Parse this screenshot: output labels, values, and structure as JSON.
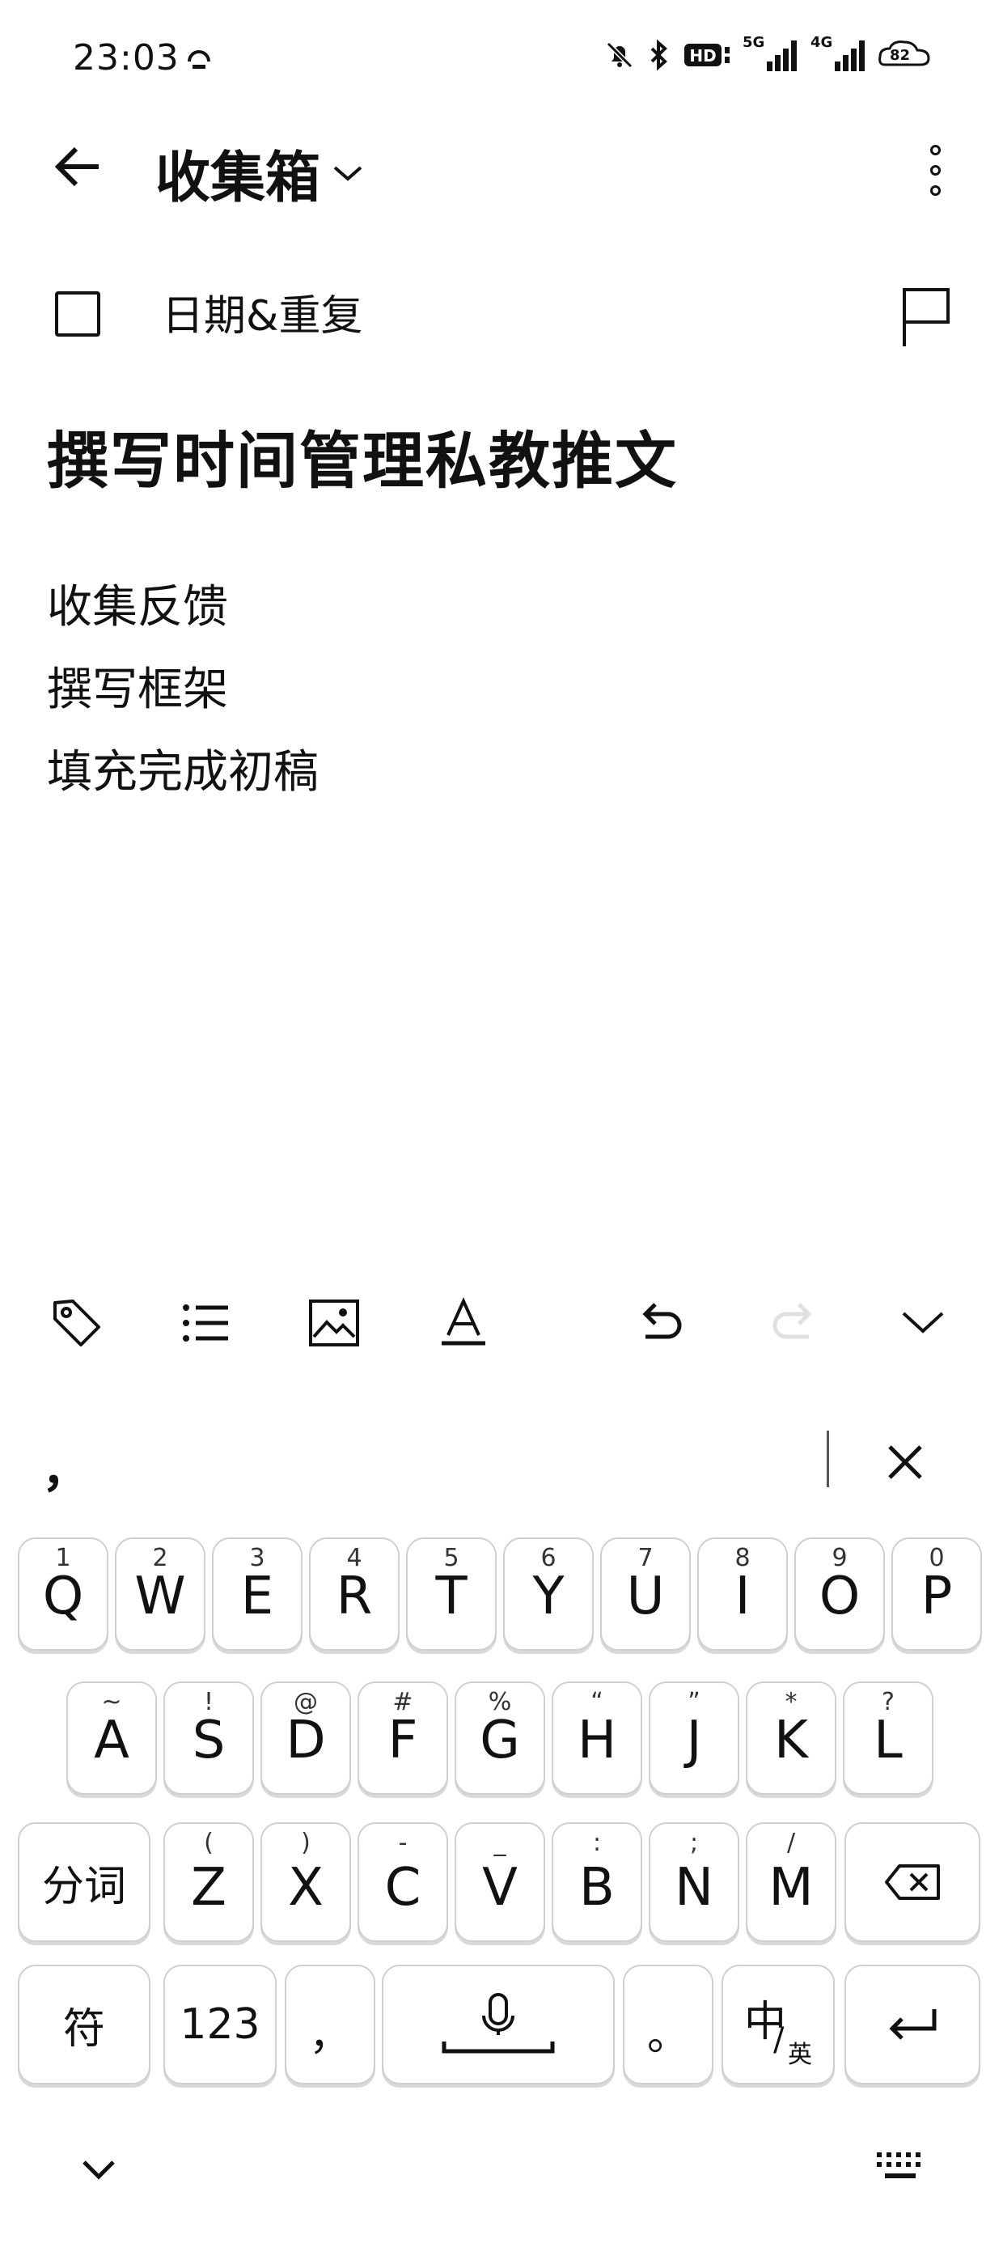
{
  "status_bar": {
    "time": "23:03",
    "icons": [
      "bell-off-icon",
      "bluetooth-icon",
      "hd-icon",
      "signal-5g-icon",
      "signal-4g-icon",
      "battery-icon"
    ],
    "signal_5g_label": "5G",
    "signal_4g_label": "4G",
    "battery_level": "82"
  },
  "header": {
    "title": "收集箱",
    "back_icon": "arrow-left-icon",
    "dropdown_icon": "chevron-down-icon",
    "more_icon": "more-vertical-icon"
  },
  "task": {
    "date_repeat_label": "日期&重复",
    "title": "撰写时间管理私教推文",
    "subtasks": [
      "收集反馈",
      "撰写框架",
      "填充完成初稿"
    ],
    "flag_icon": "flag-icon"
  },
  "toolbar": {
    "icons": [
      "tag-icon",
      "list-icon",
      "image-icon",
      "text-style-icon",
      "undo-icon",
      "redo-icon",
      "collapse-icon"
    ]
  },
  "keyboard": {
    "candidate": "，",
    "rows": [
      [
        {
          "hint": "1",
          "key": "Q"
        },
        {
          "hint": "2",
          "key": "W"
        },
        {
          "hint": "3",
          "key": "E"
        },
        {
          "hint": "4",
          "key": "R"
        },
        {
          "hint": "5",
          "key": "T"
        },
        {
          "hint": "6",
          "key": "Y"
        },
        {
          "hint": "7",
          "key": "U"
        },
        {
          "hint": "8",
          "key": "I"
        },
        {
          "hint": "9",
          "key": "O"
        },
        {
          "hint": "0",
          "key": "P"
        }
      ],
      [
        {
          "hint": "~",
          "key": "A"
        },
        {
          "hint": "!",
          "key": "S"
        },
        {
          "hint": "@",
          "key": "D"
        },
        {
          "hint": "#",
          "key": "F"
        },
        {
          "hint": "%",
          "key": "G"
        },
        {
          "hint": "“",
          "key": "H"
        },
        {
          "hint": "”",
          "key": "J"
        },
        {
          "hint": "*",
          "key": "K"
        },
        {
          "hint": "?",
          "key": "L"
        }
      ],
      [
        {
          "hint": "(",
          "key": "Z"
        },
        {
          "hint": ")",
          "key": "X"
        },
        {
          "hint": "-",
          "key": "C"
        },
        {
          "hint": "_",
          "key": "V"
        },
        {
          "hint": ":",
          "key": "B"
        },
        {
          "hint": ";",
          "key": "N"
        },
        {
          "hint": "/",
          "key": "M"
        }
      ]
    ],
    "segment_key": "分词",
    "symbol_key": "符",
    "number_key": "123",
    "comma_key": "，",
    "period_key": "。",
    "lang_key_main": "中",
    "lang_key_sub": "英",
    "lang_key_sep": "/"
  }
}
